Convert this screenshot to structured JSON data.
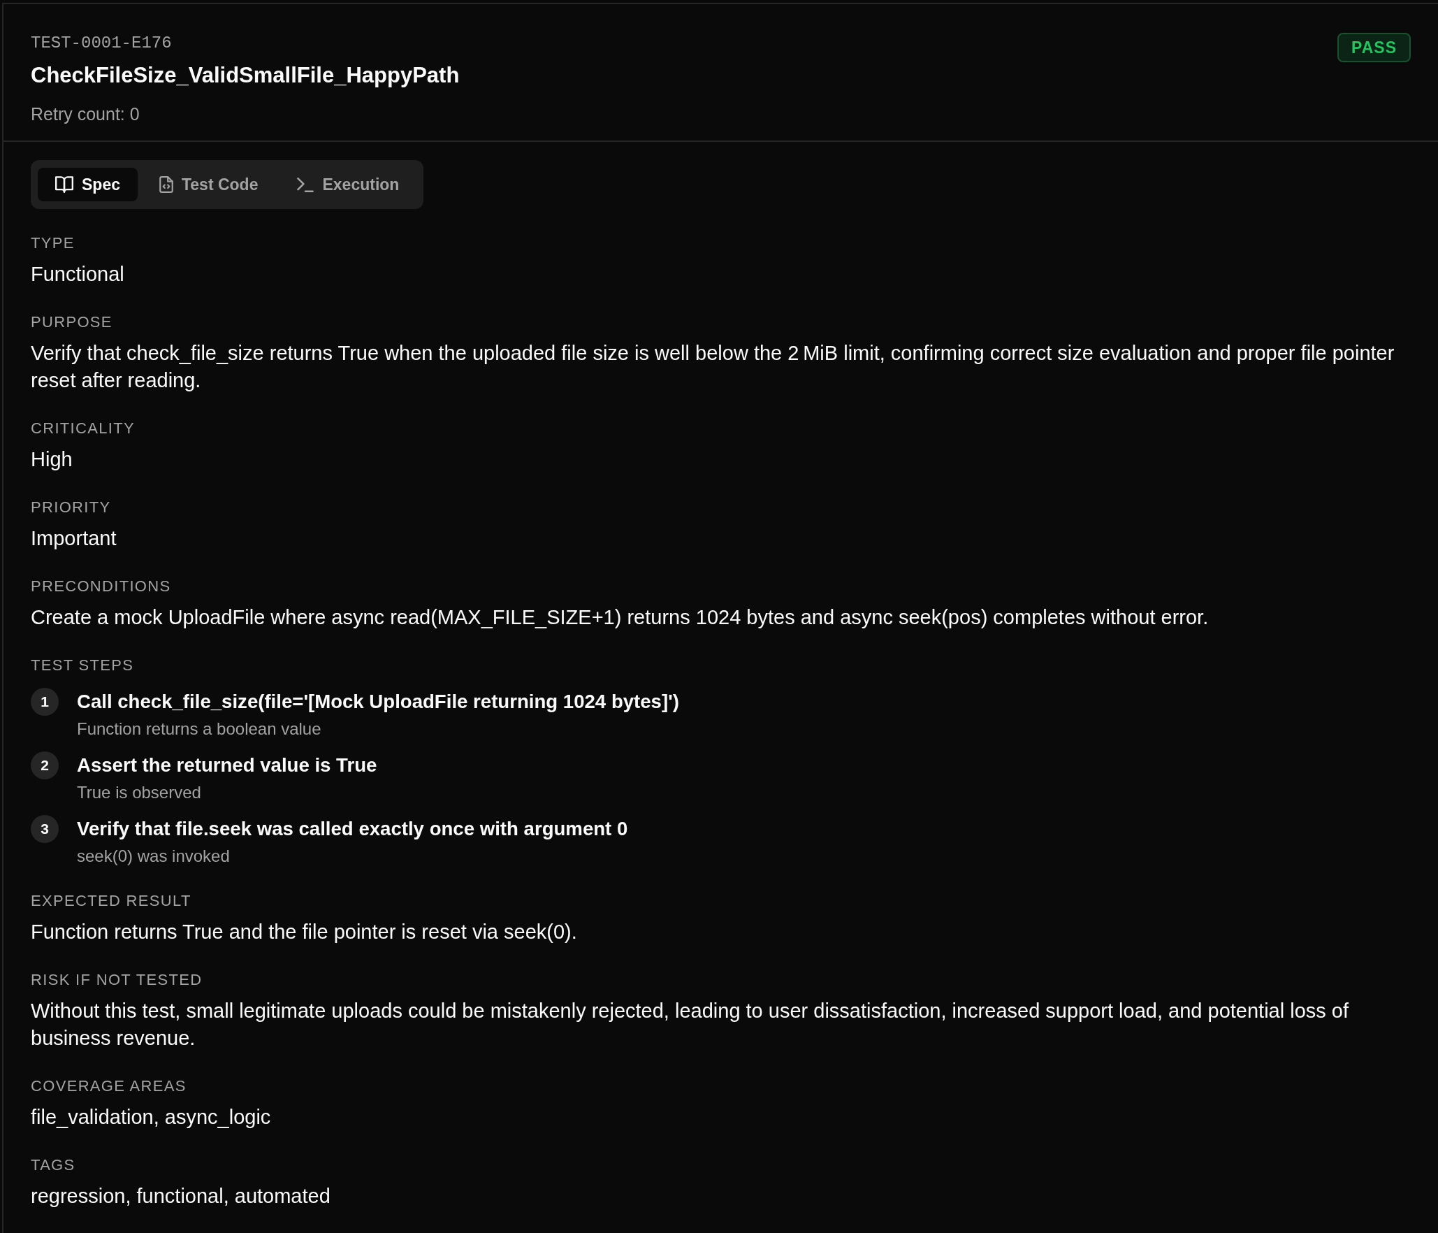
{
  "header": {
    "test_id": "TEST-0001-E176",
    "title": "CheckFileSize_ValidSmallFile_HappyPath",
    "retry_count": "Retry count: 0",
    "status": {
      "label": "PASS",
      "passed": true
    }
  },
  "tabs": [
    {
      "label": "Spec",
      "kind": "spec",
      "selected": true
    },
    {
      "label": "Test Code",
      "kind": "code",
      "selected": false
    },
    {
      "label": "Execution",
      "kind": "execution",
      "selected": false
    }
  ],
  "sections": [
    {
      "kind": "text",
      "label": "TYPE",
      "value": "Functional"
    },
    {
      "kind": "text",
      "label": "PURPOSE",
      "value": "Verify that check_file_size returns True when the uploaded file size is well below the 2 MiB limit, confirming correct size evaluation and proper file pointer reset after reading."
    },
    {
      "kind": "text",
      "label": "CRITICALITY",
      "value": "High"
    },
    {
      "kind": "text",
      "label": "PRIORITY",
      "value": "Important"
    },
    {
      "kind": "text",
      "label": "PRECONDITIONS",
      "value": "Create a mock UploadFile where async read(MAX_FILE_SIZE+1) returns 1024 bytes and async seek(pos) completes without error."
    },
    {
      "kind": "steps",
      "label": "TEST STEPS",
      "steps": [
        {
          "number": "1",
          "action": "Call check_file_size(file='[Mock UploadFile returning 1024 bytes]')",
          "expected": "Function returns a boolean value"
        },
        {
          "number": "2",
          "action": "Assert the returned value is True",
          "expected": "True is observed"
        },
        {
          "number": "3",
          "action": "Verify that file.seek was called exactly once with argument 0",
          "expected": "seek(0) was invoked"
        }
      ]
    },
    {
      "kind": "text",
      "label": "EXPECTED RESULT",
      "value": "Function returns True and the file pointer is reset via seek(0)."
    },
    {
      "kind": "text",
      "label": "RISK IF NOT TESTED",
      "value": "Without this test, small legitimate uploads could be mistakenly rejected, leading to user dissatisfaction, increased support load, and potential loss of business revenue."
    },
    {
      "kind": "text",
      "label": "COVERAGE AREAS",
      "value": "file_validation, async_logic"
    },
    {
      "kind": "text",
      "label": "TAGS",
      "value": "regression, functional, automated"
    }
  ]
}
